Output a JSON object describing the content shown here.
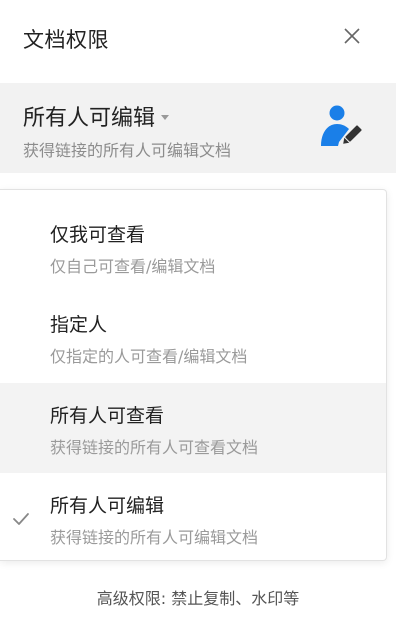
{
  "panel": {
    "title": "文档权限"
  },
  "current": {
    "title": "所有人可编辑",
    "description": "获得链接的所有人可编辑文档"
  },
  "options": [
    {
      "title": "仅我可查看",
      "description": "仅自己可查看/编辑文档",
      "selected": false
    },
    {
      "title": "指定人",
      "description": "仅指定的人可查看/编辑文档",
      "selected": false
    },
    {
      "title": "所有人可查看",
      "description": "获得链接的所有人可查看文档",
      "selected": false
    },
    {
      "title": "所有人可编辑",
      "description": "获得链接的所有人可编辑文档",
      "selected": true
    }
  ],
  "footer": {
    "advanced_label": "高级权限: 禁止复制、水印等"
  },
  "colors": {
    "accent": "#1a7fe8",
    "hover_bg": "#f3f3f3",
    "current_bg": "#f2f2f2"
  },
  "icons": {
    "close": "close-icon",
    "caret": "caret-down-icon",
    "user_edit": "user-edit-icon",
    "check": "check-icon"
  }
}
